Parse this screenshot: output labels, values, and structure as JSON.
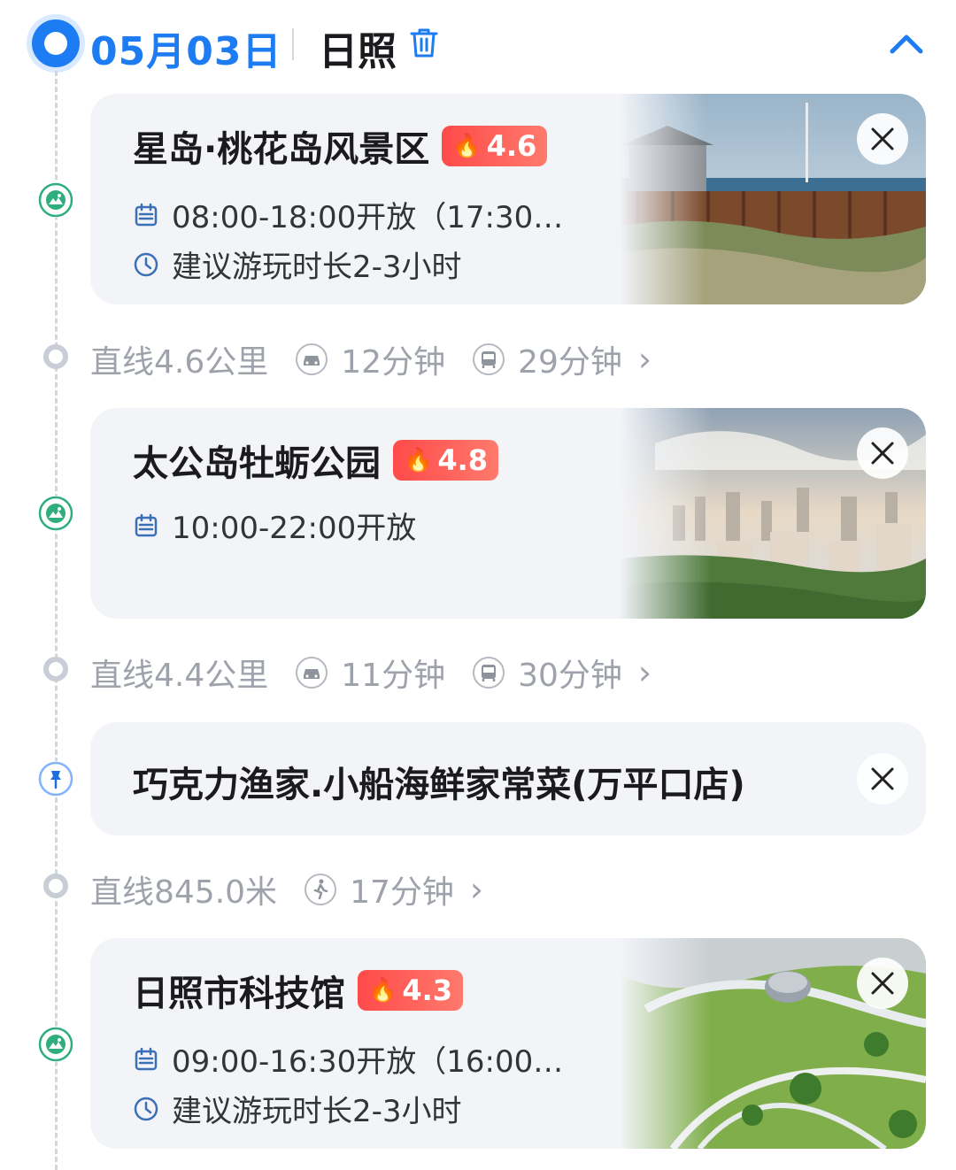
{
  "header": {
    "date": "05月03日",
    "city": "日照",
    "trash_icon": "trash-icon",
    "collapse_icon": "chevron-up-icon",
    "accent": "#1d7cf2"
  },
  "stops": [
    {
      "kind": "scenic",
      "icon": "scenic-spot-icon",
      "title": "星岛·桃花岛风景区",
      "rating": "4.6",
      "hours": "08:00-18:00开放（17:30停…",
      "duration": "建议游玩时长2-3小时",
      "image": "seaside-boardwalk-photo"
    },
    {
      "kind": "scenic",
      "icon": "scenic-spot-icon",
      "title": "太公岛牡蛎公园",
      "rating": "4.8",
      "hours": "10:00-22:00开放",
      "image": "city-skyline-photo"
    },
    {
      "kind": "restaurant",
      "icon": "pin-icon",
      "title": "巧克力渔家.小船海鲜家常菜(万平口店)"
    },
    {
      "kind": "scenic",
      "icon": "scenic-spot-icon",
      "title": "日照市科技馆",
      "rating": "4.3",
      "hours": "09:00-16:30开放（16:00停…",
      "duration": "建议游玩时长2-3小时",
      "image": "science-museum-aerial-photo"
    }
  ],
  "routes": [
    {
      "distance": "直线4.6公里",
      "drive": "12分钟",
      "bus": "29分钟"
    },
    {
      "distance": "直线4.4公里",
      "drive": "11分钟",
      "bus": "30分钟"
    },
    {
      "distance": "直线845.0米",
      "walk": "17分钟"
    }
  ],
  "colors": {
    "rating_badge": "#ff4a4a",
    "scenic_icon": "#2eae7e",
    "pin_icon": "#1d6fe0",
    "route_text": "#9ea2ab",
    "card_bg": "#f2f4f8"
  }
}
